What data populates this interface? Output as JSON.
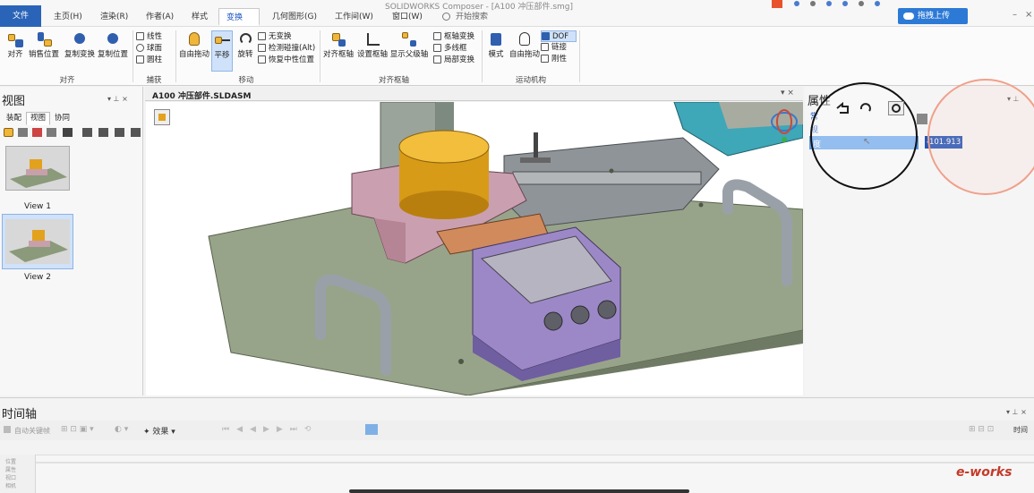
{
  "app": {
    "title": "SOLIDWORKS Composer - [A100 冲压部件.smg]",
    "search_placeholder": "开始搜索",
    "upload_label": "拖拽上传"
  },
  "tabs": [
    {
      "label": "文件"
    },
    {
      "label": "主页(H)"
    },
    {
      "label": "渲染(R)"
    },
    {
      "label": "作者(A)"
    },
    {
      "label": "样式"
    },
    {
      "label": "变换(T)"
    },
    {
      "label": "几何图形(G)"
    },
    {
      "label": "工作间(W)"
    },
    {
      "label": "窗口(W)"
    }
  ],
  "ribbon": {
    "align": {
      "btn1": "对齐",
      "btn2": "销售位置",
      "btn3": "复制变换",
      "btn4": "复制位置",
      "group": "对齐"
    },
    "capture": {
      "s1": "线性",
      "s2": "球面",
      "s3": "圆柱",
      "group": "捕获"
    },
    "move": {
      "free_drag": "自由拖动",
      "translate": "平移",
      "rotate": "旋转",
      "s1": "无变换",
      "s2": "检测碰撞(Alt)",
      "s3": "恢复中性位置",
      "group": "移动"
    },
    "pivot": {
      "align_pivot": "对齐枢轴",
      "set_pivot": "设置枢轴",
      "show_parent": "显示父级轴",
      "s1": "枢轴变换",
      "s2": "多线框",
      "s3": "局部变换",
      "group": "对齐枢轴"
    },
    "kin": {
      "mode": "模式",
      "free_drag": "自由拖动",
      "s1": "DOF",
      "s2": "链接",
      "s3": "刚性",
      "group": "运动机构"
    }
  },
  "left_panel": {
    "title": "视图",
    "subtabs": [
      "装配",
      "视图",
      "协同"
    ],
    "views": [
      {
        "label": "View 1"
      },
      {
        "label": "View 2"
      }
    ]
  },
  "document": {
    "tab_title": "A100 冲压部件.SLDASM"
  },
  "right_panel": {
    "title": "属性",
    "rows": [
      "常",
      "规",
      "度"
    ],
    "value": "-101.913"
  },
  "timeline": {
    "title": "时间轴",
    "auto_key": "自动关键帧",
    "effects": "效果",
    "time_label": "时间",
    "side_labels": [
      "位置",
      "属性",
      "视口",
      "相机"
    ]
  },
  "watermark": "e-works",
  "colors": {
    "accent": "#2a64b8",
    "highlight": "#cfe2f9",
    "selection": "#5b9be6"
  }
}
